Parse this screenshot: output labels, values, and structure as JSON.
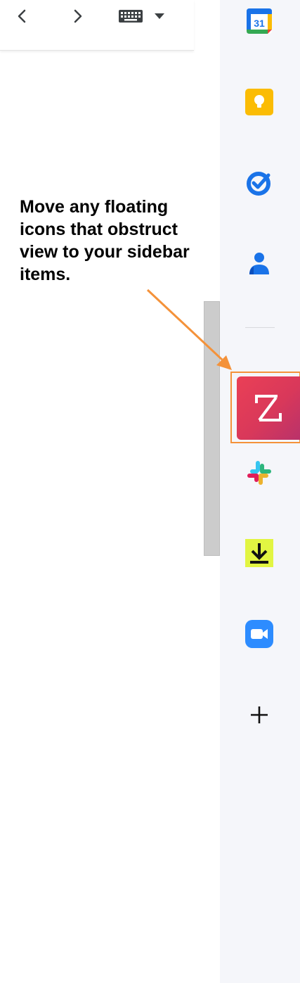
{
  "toolbar": {
    "prev_icon": "chevron-left-icon",
    "next_icon": "chevron-right-icon",
    "keyboard_icon": "keyboard-icon",
    "caret_icon": "caret-down-icon"
  },
  "instruction": {
    "text": "Move any floating icons that obstruct view to your sidebar items."
  },
  "sidepanel": {
    "items": [
      {
        "name": "calendar-icon",
        "label": "31"
      },
      {
        "name": "keep-icon"
      },
      {
        "name": "tasks-icon"
      },
      {
        "name": "contacts-icon"
      },
      {
        "name": "zoho-icon"
      },
      {
        "name": "slack-icon"
      },
      {
        "name": "download-icon"
      },
      {
        "name": "zoom-icon"
      },
      {
        "name": "add-icon"
      }
    ]
  },
  "colors": {
    "accent_orange": "#f4923a",
    "panel_bg": "#f5f6fa",
    "zoho_red": "#e23d57"
  }
}
